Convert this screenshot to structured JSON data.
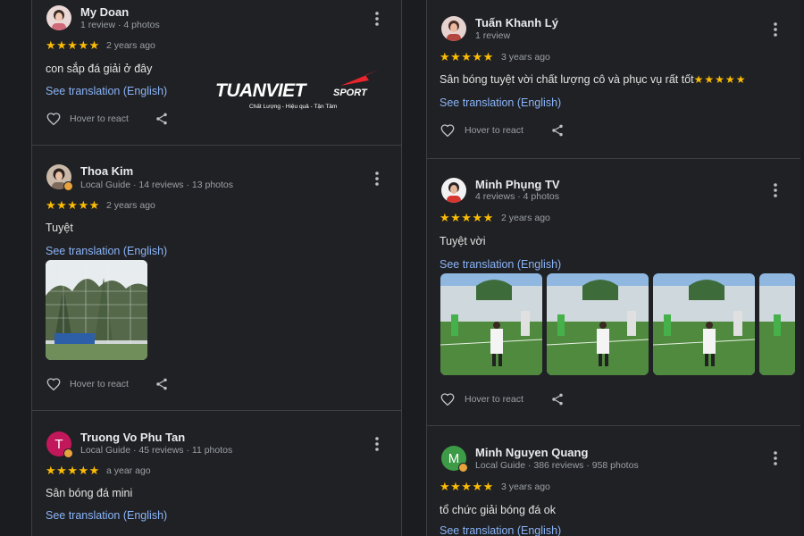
{
  "left_column": {
    "reviews": [
      {
        "name": "My Doan",
        "meta": "1 review · 4 photos",
        "stars": "★★★★★",
        "date": "2 years ago",
        "text": "con sắp đá giải ở đây",
        "translation_link": "See translation (English)",
        "react_label": "Hover to react"
      },
      {
        "name": "Thoa Kim",
        "meta": "Local Guide · 14 reviews · 13 photos",
        "stars": "★★★★★",
        "date": "2 years ago",
        "text": "Tuyệt",
        "translation_link": "See translation (English)",
        "react_label": "Hover to react"
      },
      {
        "name": "Truong Vo Phu Tan",
        "avatar_initial": "T",
        "avatar_color": "#c2185b",
        "meta": "Local Guide · 45 reviews · 11 photos",
        "stars": "★★★★★",
        "date": "a year ago",
        "text": "Sân bóng đá mini",
        "translation_link": "See translation (English)"
      }
    ]
  },
  "right_column": {
    "reviews": [
      {
        "name": "Tuấn Khanh Lý",
        "meta": "1 review",
        "stars": "★★★★★",
        "date": "3 years ago",
        "text": "Sân bóng tuyệt vời chất lượng cô và phục vụ rất tốt",
        "emoji": "★★★★★",
        "translation_link": "See translation (English)",
        "react_label": "Hover to react"
      },
      {
        "name": "Minh Phụng TV",
        "meta": "4 reviews · 4 photos",
        "stars": "★★★★★",
        "date": "2 years ago",
        "text": "Tuyệt vời",
        "translation_link": "See translation (English)",
        "react_label": "Hover to react"
      },
      {
        "name": "Minh Nguyen Quang",
        "avatar_initial": "M",
        "avatar_color": "#3d9b47",
        "meta": "Local Guide · 386 reviews · 958 photos",
        "stars": "★★★★★",
        "date": "3 years ago",
        "text": "tổ chức giải bóng đá ok",
        "translation_link": "See translation (English)"
      }
    ]
  },
  "watermark": {
    "brand": "TUANVIET",
    "brand_suffix": "SPORT",
    "tagline": "Chất Lượng - Hiệu quả - Tận Tâm"
  },
  "colors": {
    "background": "#202124",
    "star": "#fbbc04",
    "link": "#8ab4f8",
    "muted": "#9aa0a6"
  }
}
